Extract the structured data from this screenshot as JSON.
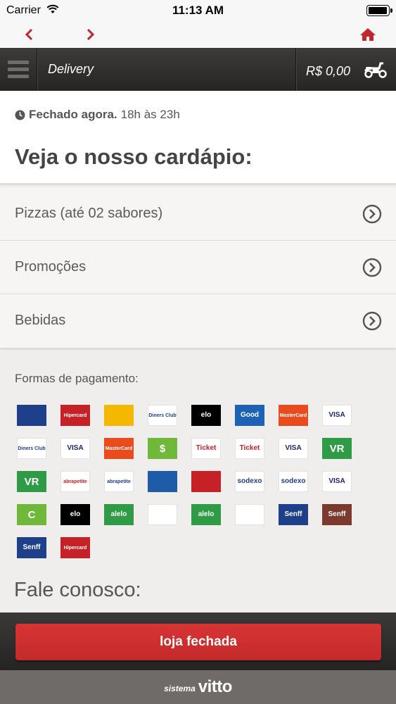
{
  "status_bar": {
    "carrier": "Carrier",
    "time": "11:13 AM",
    "battery_level": 1.0
  },
  "nav": {
    "back_icon": "chevron-left-icon",
    "forward_icon": "chevron-right-icon",
    "home_icon": "home-icon",
    "accent": "#c0262b"
  },
  "header": {
    "title": "Delivery",
    "cart_total": "R$ 0,00",
    "cart_icon": "scooter-icon"
  },
  "info": {
    "status": "Fechado agora.",
    "hours": "18h às 23h",
    "heading": "Veja o nosso cardápio:"
  },
  "menu": {
    "items": [
      {
        "label": "Pizzas (até 02 sabores)"
      },
      {
        "label": "Promoções"
      },
      {
        "label": "Bebidas"
      }
    ]
  },
  "payment": {
    "title": "Formas de pagamento:",
    "cards": [
      {
        "name": "Diners",
        "label": "",
        "bg": "#1e3f8a",
        "fg": "#ffffff"
      },
      {
        "name": "Hipercard",
        "label": "Hipercard",
        "bg": "#c62127",
        "fg": "#ffffff"
      },
      {
        "name": "Aura",
        "label": "",
        "bg": "#f5b800",
        "fg": "#1b5fa8"
      },
      {
        "name": "Diners Club International",
        "label": "Diners Club",
        "bg": "#ffffff",
        "fg": "#1e3f8a"
      },
      {
        "name": "Elo",
        "label": "elo",
        "bg": "#000000",
        "fg": "#ffffff"
      },
      {
        "name": "Good Card",
        "label": "Good",
        "bg": "#1d63b5",
        "fg": "#ffffff"
      },
      {
        "name": "MasterCard",
        "label": "MasterCard",
        "bg": "#ea4b1c",
        "fg": "#ffffff"
      },
      {
        "name": "Visa",
        "label": "VISA",
        "bg": "#ffffff",
        "fg": "#1a1f71"
      },
      {
        "name": "Diners Club International",
        "label": "Diners Club",
        "bg": "#ffffff",
        "fg": "#1e3f8a"
      },
      {
        "name": "Visa Electron",
        "label": "VISA",
        "bg": "#ffffff",
        "fg": "#1a1f71"
      },
      {
        "name": "MasterCard",
        "label": "MasterCard",
        "bg": "#ea4b1c",
        "fg": "#ffffff"
      },
      {
        "name": "Cash",
        "label": "$",
        "bg": "#6fb83a",
        "fg": "#ffffff"
      },
      {
        "name": "Ticket",
        "label": "Ticket",
        "bg": "#ffffff",
        "fg": "#c62127"
      },
      {
        "name": "Ticket Restaurante",
        "label": "Ticket",
        "bg": "#ffffff",
        "fg": "#c62127"
      },
      {
        "name": "Visa Vale Alimentação",
        "label": "VISA",
        "bg": "#ffffff",
        "fg": "#1a1f71"
      },
      {
        "name": "VR",
        "label": "VR",
        "bg": "#2f9b47",
        "fg": "#ffffff"
      },
      {
        "name": "VR",
        "label": "VR",
        "bg": "#2f9b47",
        "fg": "#ffffff"
      },
      {
        "name": "Abrapetite Alimentação",
        "label": "abrapetite",
        "bg": "#ffffff",
        "fg": "#c62127"
      },
      {
        "name": "Abrapetite Refeição",
        "label": "abrapetite",
        "bg": "#ffffff",
        "fg": "#1e3f8a"
      },
      {
        "name": "Sapore Refeição",
        "label": "",
        "bg": "#1e5ba8",
        "fg": "#ffffff"
      },
      {
        "name": "Sapore Alimentação",
        "label": "",
        "bg": "#c62127",
        "fg": "#ffffff"
      },
      {
        "name": "Sodexo Refeição",
        "label": "sodexo",
        "bg": "#ffffff",
        "fg": "#1e3f8a"
      },
      {
        "name": "Sodexo Alimentação",
        "label": "sodexo",
        "bg": "#ffffff",
        "fg": "#1e3f8a"
      },
      {
        "name": "Visa Vale Refeição",
        "label": "VISA",
        "bg": "#ffffff",
        "fg": "#1a1f71"
      },
      {
        "name": "Cheque",
        "label": "C",
        "bg": "#6fb83a",
        "fg": "#ffffff"
      },
      {
        "name": "Elo",
        "label": "elo",
        "bg": "#000000",
        "fg": "#ffffff"
      },
      {
        "name": "Alelo Refeição",
        "label": "alelo",
        "bg": "#2f9b47",
        "fg": "#ffffff"
      },
      {
        "name": "Green Card Refeição",
        "label": "",
        "bg": "#ffffff",
        "fg": "#2f9b47"
      },
      {
        "name": "Alelo Alimentação",
        "label": "alelo",
        "bg": "#2f9b47",
        "fg": "#ffffff"
      },
      {
        "name": "Green Card Alimentação",
        "label": "",
        "bg": "#ffffff",
        "fg": "#2f9b47"
      },
      {
        "name": "Senff",
        "label": "Senff",
        "bg": "#1e3f8a",
        "fg": "#ffffff"
      },
      {
        "name": "Senff",
        "label": "Senff",
        "bg": "#7a3b2e",
        "fg": "#ffffff"
      },
      {
        "name": "Senff Refeição",
        "label": "Senff",
        "bg": "#1e3f8a",
        "fg": "#ffffff"
      },
      {
        "name": "Hipercard",
        "label": "Hipercard",
        "bg": "#c62127",
        "fg": "#ffffff"
      }
    ]
  },
  "contact": {
    "title": "Fale conosco:"
  },
  "bottom": {
    "button_label": "loja fechada",
    "button_color": "#d03030"
  },
  "footer": {
    "small": "sistema",
    "brand": "vitto"
  }
}
